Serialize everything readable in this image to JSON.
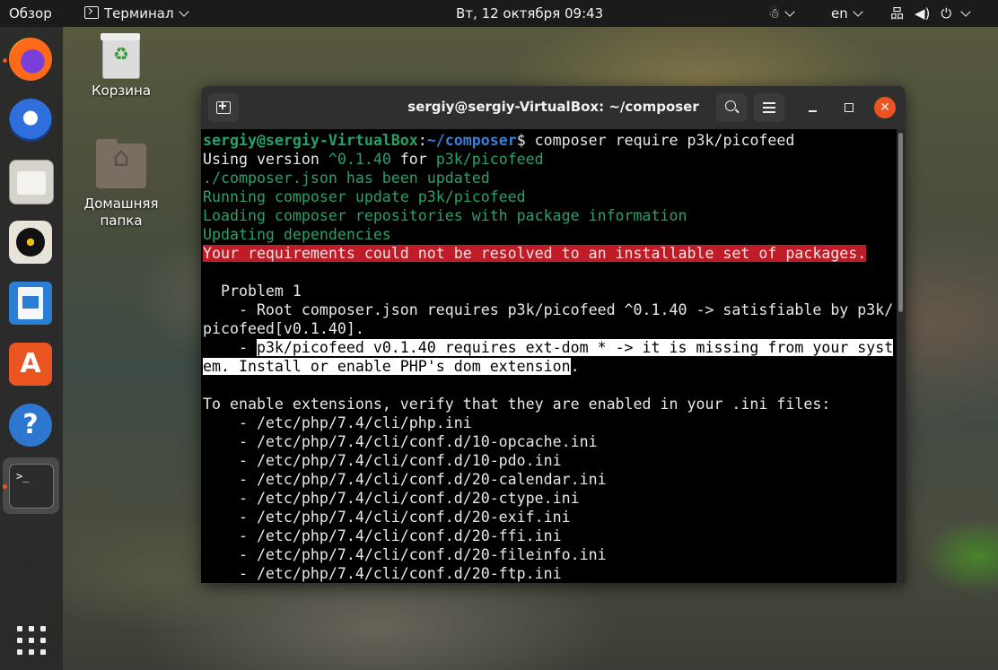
{
  "topbar": {
    "activities": "Обзор",
    "app_menu": "Терминал",
    "clock": "Вт, 12 октября  09:43",
    "accessibility_icon": "accessibility-icon",
    "language": "en",
    "network_icon": "network-icon",
    "volume_icon": "volume-icon",
    "power_icon": "power-icon"
  },
  "dock": {
    "items": [
      {
        "icon": "firefox-icon",
        "running": true
      },
      {
        "icon": "thunderbird-icon",
        "running": false
      },
      {
        "icon": "files-icon",
        "running": false
      },
      {
        "icon": "rhythmbox-icon",
        "running": false
      },
      {
        "icon": "libreoffice-writer-icon",
        "running": false
      },
      {
        "icon": "ubuntu-software-icon",
        "glyph": "A",
        "running": false
      },
      {
        "icon": "help-icon",
        "glyph": "?",
        "running": false
      },
      {
        "icon": "terminal-icon",
        "glyph": ">_",
        "running": true,
        "active": true
      }
    ],
    "show_apps_icon": "apps-grid-icon"
  },
  "desktop": {
    "trash_label": "Корзина",
    "home_label_line1": "Домашняя",
    "home_label_line2": "папка"
  },
  "window": {
    "title": "sergiy@sergiy-VirtualBox: ~/composer",
    "close_glyph": "✕"
  },
  "terminal": {
    "prompt_user": "sergiy@sergiy-VirtualBox",
    "prompt_colon": ":",
    "prompt_path": "~/composer",
    "prompt_symbol": "$ ",
    "command": "composer require p3k/picofeed",
    "line_using_1": "Using version ",
    "line_using_version": "^0.1.40",
    "line_using_2": " for ",
    "line_using_pkg": "p3k/picofeed",
    "line_updated": "./composer.json has been updated",
    "line_running": "Running composer update p3k/picofeed",
    "line_loading": "Loading composer repositories with package information",
    "line_updating": "Updating dependencies",
    "line_error": "Your requirements could not be resolved to an installable set of packages.",
    "problem_header": "  Problem 1",
    "problem_line1": "    - Root composer.json requires p3k/picofeed ^0.1.40 -> satisfiable by p3k/",
    "problem_line2": "picofeed[v0.1.40].",
    "problem_line3_prefix": "    - ",
    "problem_line3_hl": "p3k/picofeed v0.1.40 requires ext-dom * -> it is missing from your syst",
    "problem_line4_hl": "em. Install or enable PHP's dom extension",
    "problem_line4_suffix": ".",
    "ext_intro": "To enable extensions, verify that they are enabled in your .ini files:",
    "ini_files": [
      "    - /etc/php/7.4/cli/php.ini",
      "    - /etc/php/7.4/cli/conf.d/10-opcache.ini",
      "    - /etc/php/7.4/cli/conf.d/10-pdo.ini",
      "    - /etc/php/7.4/cli/conf.d/20-calendar.ini",
      "    - /etc/php/7.4/cli/conf.d/20-ctype.ini",
      "    - /etc/php/7.4/cli/conf.d/20-exif.ini",
      "    - /etc/php/7.4/cli/conf.d/20-ffi.ini",
      "    - /etc/php/7.4/cli/conf.d/20-fileinfo.ini",
      "    - /etc/php/7.4/cli/conf.d/20-ftp.ini"
    ]
  }
}
